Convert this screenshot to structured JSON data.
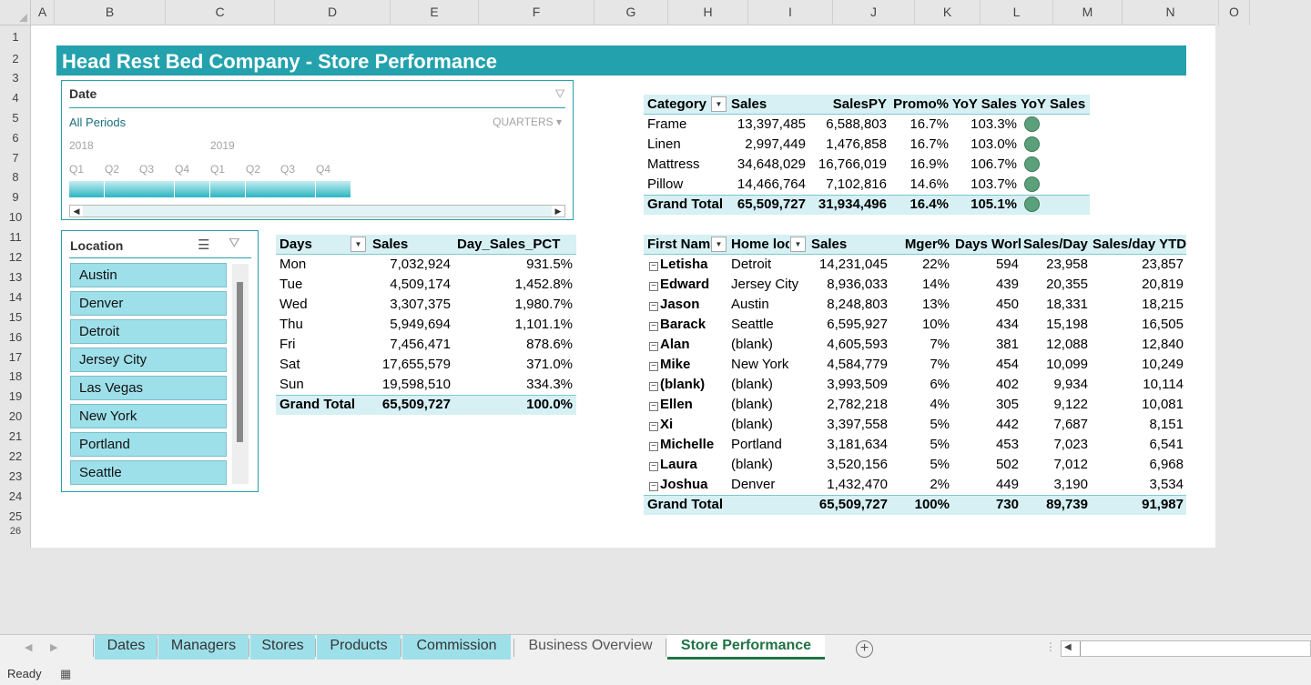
{
  "title": "Head Rest Bed Company - Store Performance",
  "columns": [
    "A",
    "B",
    "C",
    "D",
    "E",
    "F",
    "G",
    "H",
    "I",
    "J",
    "K",
    "L",
    "M",
    "N",
    "O"
  ],
  "rows": [
    "1",
    "2",
    "3",
    "4",
    "5",
    "6",
    "7",
    "8",
    "9",
    "10",
    "11",
    "12",
    "13",
    "14",
    "15",
    "16",
    "17",
    "18",
    "19",
    "20",
    "21",
    "22",
    "23",
    "24",
    "25",
    "26"
  ],
  "timeline": {
    "title": "Date",
    "period": "All Periods",
    "level": "QUARTERS ▾",
    "years": [
      "2018",
      "2019"
    ],
    "quarters": [
      "Q1",
      "Q2",
      "Q3",
      "Q4",
      "Q1",
      "Q2",
      "Q3",
      "Q4"
    ],
    "filter_icon": "clear-filter-icon"
  },
  "location_slicer": {
    "title": "Location",
    "items": [
      "Austin",
      "Denver",
      "Detroit",
      "Jersey City",
      "Las Vegas",
      "New York",
      "Portland",
      "Seattle"
    ]
  },
  "category_pivot": {
    "headers": [
      "Category",
      "Sales",
      "SalesPY",
      "Promo%",
      "YoY Sales",
      "YoY Sales"
    ],
    "rows": [
      {
        "label": "Frame",
        "sales": "13,397,485",
        "salespy": "6,588,803",
        "promo": "16.7%",
        "yoy": "103.3%"
      },
      {
        "label": "Linen",
        "sales": "2,997,449",
        "salespy": "1,476,858",
        "promo": "16.7%",
        "yoy": "103.0%"
      },
      {
        "label": "Mattress",
        "sales": "34,648,029",
        "salespy": "16,766,019",
        "promo": "16.9%",
        "yoy": "106.7%"
      },
      {
        "label": "Pillow",
        "sales": "14,466,764",
        "salespy": "7,102,816",
        "promo": "14.6%",
        "yoy": "103.7%"
      }
    ],
    "total": {
      "label": "Grand Total",
      "sales": "65,509,727",
      "salespy": "31,934,496",
      "promo": "16.4%",
      "yoy": "105.1%"
    },
    "indicator_color": "#5aa07a"
  },
  "days_pivot": {
    "headers": [
      "Days",
      "Sales",
      "Day_Sales_PCT"
    ],
    "rows": [
      {
        "day": "Mon",
        "sales": "7,032,924",
        "pct": "931.5%"
      },
      {
        "day": "Tue",
        "sales": "4,509,174",
        "pct": "1,452.8%"
      },
      {
        "day": "Wed",
        "sales": "3,307,375",
        "pct": "1,980.7%"
      },
      {
        "day": "Thu",
        "sales": "5,949,694",
        "pct": "1,101.1%"
      },
      {
        "day": "Fri",
        "sales": "7,456,471",
        "pct": "878.6%"
      },
      {
        "day": "Sat",
        "sales": "17,655,579",
        "pct": "371.0%"
      },
      {
        "day": "Sun",
        "sales": "19,598,510",
        "pct": "334.3%"
      }
    ],
    "total": {
      "day": "Grand Total",
      "sales": "65,509,727",
      "pct": "100.0%"
    }
  },
  "manager_pivot": {
    "headers": [
      "First Nam",
      "Home loc",
      "Sales",
      "Mger%",
      "Days Worl",
      "Sales/Day",
      "Sales/day YTD"
    ],
    "rows": [
      {
        "name": "Letisha",
        "home": "Detroit",
        "sales": "14,231,045",
        "mger": "22%",
        "days": "594",
        "spd": "23,958",
        "ytd": "23,857"
      },
      {
        "name": "Edward",
        "home": "Jersey City",
        "sales": "8,936,033",
        "mger": "14%",
        "days": "439",
        "spd": "20,355",
        "ytd": "20,819"
      },
      {
        "name": "Jason",
        "home": "Austin",
        "sales": "8,248,803",
        "mger": "13%",
        "days": "450",
        "spd": "18,331",
        "ytd": "18,215"
      },
      {
        "name": "Barack",
        "home": "Seattle",
        "sales": "6,595,927",
        "mger": "10%",
        "days": "434",
        "spd": "15,198",
        "ytd": "16,505"
      },
      {
        "name": "Alan",
        "home": "(blank)",
        "sales": "4,605,593",
        "mger": "7%",
        "days": "381",
        "spd": "12,088",
        "ytd": "12,840"
      },
      {
        "name": "Mike",
        "home": "New York",
        "sales": "4,584,779",
        "mger": "7%",
        "days": "454",
        "spd": "10,099",
        "ytd": "10,249"
      },
      {
        "name": "(blank)",
        "home": "(blank)",
        "sales": "3,993,509",
        "mger": "6%",
        "days": "402",
        "spd": "9,934",
        "ytd": "10,114"
      },
      {
        "name": "Ellen",
        "home": "(blank)",
        "sales": "2,782,218",
        "mger": "4%",
        "days": "305",
        "spd": "9,122",
        "ytd": "10,081"
      },
      {
        "name": "Xi",
        "home": "(blank)",
        "sales": "3,397,558",
        "mger": "5%",
        "days": "442",
        "spd": "7,687",
        "ytd": "8,151"
      },
      {
        "name": "Michelle",
        "home": "Portland",
        "sales": "3,181,634",
        "mger": "5%",
        "days": "453",
        "spd": "7,023",
        "ytd": "6,541"
      },
      {
        "name": "Laura",
        "home": "(blank)",
        "sales": "3,520,156",
        "mger": "5%",
        "days": "502",
        "spd": "7,012",
        "ytd": "6,968"
      },
      {
        "name": "Joshua",
        "home": "Denver",
        "sales": "1,432,470",
        "mger": "2%",
        "days": "449",
        "spd": "3,190",
        "ytd": "3,534"
      }
    ],
    "total": {
      "name": "Grand Total",
      "sales": "65,509,727",
      "mger": "100%",
      "days": "730",
      "spd": "89,739",
      "ytd": "91,987"
    }
  },
  "sheet_tabs": [
    {
      "label": "Dates",
      "style": "colored"
    },
    {
      "label": "Managers",
      "style": "colored"
    },
    {
      "label": "Stores",
      "style": "colored"
    },
    {
      "label": "Products",
      "style": "colored"
    },
    {
      "label": "Commission",
      "style": "colored"
    },
    {
      "label": "Business Overview",
      "style": "plain"
    },
    {
      "label": "Store Performance",
      "style": "active"
    }
  ],
  "status": {
    "text": "Ready"
  }
}
